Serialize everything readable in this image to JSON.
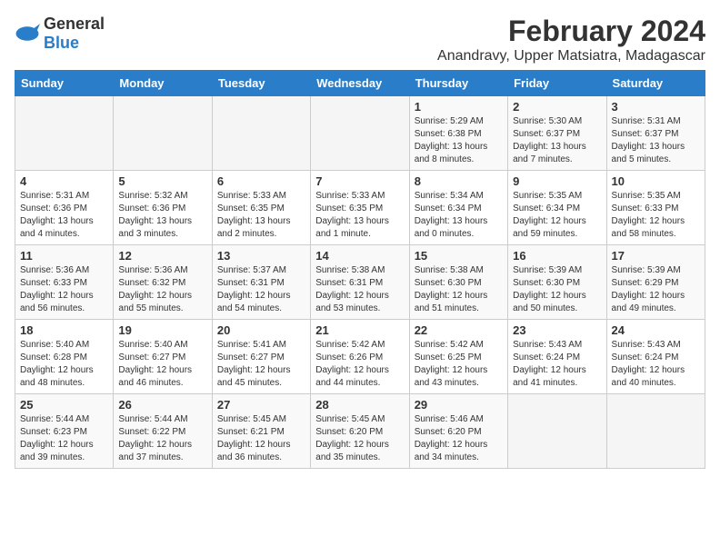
{
  "logo": {
    "general": "General",
    "blue": "Blue"
  },
  "title": "February 2024",
  "subtitle": "Anandravy, Upper Matsiatra, Madagascar",
  "weekdays": [
    "Sunday",
    "Monday",
    "Tuesday",
    "Wednesday",
    "Thursday",
    "Friday",
    "Saturday"
  ],
  "weeks": [
    [
      {
        "day": "",
        "info": ""
      },
      {
        "day": "",
        "info": ""
      },
      {
        "day": "",
        "info": ""
      },
      {
        "day": "",
        "info": ""
      },
      {
        "day": "1",
        "info": "Sunrise: 5:29 AM\nSunset: 6:38 PM\nDaylight: 13 hours\nand 8 minutes."
      },
      {
        "day": "2",
        "info": "Sunrise: 5:30 AM\nSunset: 6:37 PM\nDaylight: 13 hours\nand 7 minutes."
      },
      {
        "day": "3",
        "info": "Sunrise: 5:31 AM\nSunset: 6:37 PM\nDaylight: 13 hours\nand 5 minutes."
      }
    ],
    [
      {
        "day": "4",
        "info": "Sunrise: 5:31 AM\nSunset: 6:36 PM\nDaylight: 13 hours\nand 4 minutes."
      },
      {
        "day": "5",
        "info": "Sunrise: 5:32 AM\nSunset: 6:36 PM\nDaylight: 13 hours\nand 3 minutes."
      },
      {
        "day": "6",
        "info": "Sunrise: 5:33 AM\nSunset: 6:35 PM\nDaylight: 13 hours\nand 2 minutes."
      },
      {
        "day": "7",
        "info": "Sunrise: 5:33 AM\nSunset: 6:35 PM\nDaylight: 13 hours\nand 1 minute."
      },
      {
        "day": "8",
        "info": "Sunrise: 5:34 AM\nSunset: 6:34 PM\nDaylight: 13 hours\nand 0 minutes."
      },
      {
        "day": "9",
        "info": "Sunrise: 5:35 AM\nSunset: 6:34 PM\nDaylight: 12 hours\nand 59 minutes."
      },
      {
        "day": "10",
        "info": "Sunrise: 5:35 AM\nSunset: 6:33 PM\nDaylight: 12 hours\nand 58 minutes."
      }
    ],
    [
      {
        "day": "11",
        "info": "Sunrise: 5:36 AM\nSunset: 6:33 PM\nDaylight: 12 hours\nand 56 minutes."
      },
      {
        "day": "12",
        "info": "Sunrise: 5:36 AM\nSunset: 6:32 PM\nDaylight: 12 hours\nand 55 minutes."
      },
      {
        "day": "13",
        "info": "Sunrise: 5:37 AM\nSunset: 6:31 PM\nDaylight: 12 hours\nand 54 minutes."
      },
      {
        "day": "14",
        "info": "Sunrise: 5:38 AM\nSunset: 6:31 PM\nDaylight: 12 hours\nand 53 minutes."
      },
      {
        "day": "15",
        "info": "Sunrise: 5:38 AM\nSunset: 6:30 PM\nDaylight: 12 hours\nand 51 minutes."
      },
      {
        "day": "16",
        "info": "Sunrise: 5:39 AM\nSunset: 6:30 PM\nDaylight: 12 hours\nand 50 minutes."
      },
      {
        "day": "17",
        "info": "Sunrise: 5:39 AM\nSunset: 6:29 PM\nDaylight: 12 hours\nand 49 minutes."
      }
    ],
    [
      {
        "day": "18",
        "info": "Sunrise: 5:40 AM\nSunset: 6:28 PM\nDaylight: 12 hours\nand 48 minutes."
      },
      {
        "day": "19",
        "info": "Sunrise: 5:40 AM\nSunset: 6:27 PM\nDaylight: 12 hours\nand 46 minutes."
      },
      {
        "day": "20",
        "info": "Sunrise: 5:41 AM\nSunset: 6:27 PM\nDaylight: 12 hours\nand 45 minutes."
      },
      {
        "day": "21",
        "info": "Sunrise: 5:42 AM\nSunset: 6:26 PM\nDaylight: 12 hours\nand 44 minutes."
      },
      {
        "day": "22",
        "info": "Sunrise: 5:42 AM\nSunset: 6:25 PM\nDaylight: 12 hours\nand 43 minutes."
      },
      {
        "day": "23",
        "info": "Sunrise: 5:43 AM\nSunset: 6:24 PM\nDaylight: 12 hours\nand 41 minutes."
      },
      {
        "day": "24",
        "info": "Sunrise: 5:43 AM\nSunset: 6:24 PM\nDaylight: 12 hours\nand 40 minutes."
      }
    ],
    [
      {
        "day": "25",
        "info": "Sunrise: 5:44 AM\nSunset: 6:23 PM\nDaylight: 12 hours\nand 39 minutes."
      },
      {
        "day": "26",
        "info": "Sunrise: 5:44 AM\nSunset: 6:22 PM\nDaylight: 12 hours\nand 37 minutes."
      },
      {
        "day": "27",
        "info": "Sunrise: 5:45 AM\nSunset: 6:21 PM\nDaylight: 12 hours\nand 36 minutes."
      },
      {
        "day": "28",
        "info": "Sunrise: 5:45 AM\nSunset: 6:20 PM\nDaylight: 12 hours\nand 35 minutes."
      },
      {
        "day": "29",
        "info": "Sunrise: 5:46 AM\nSunset: 6:20 PM\nDaylight: 12 hours\nand 34 minutes."
      },
      {
        "day": "",
        "info": ""
      },
      {
        "day": "",
        "info": ""
      }
    ]
  ]
}
